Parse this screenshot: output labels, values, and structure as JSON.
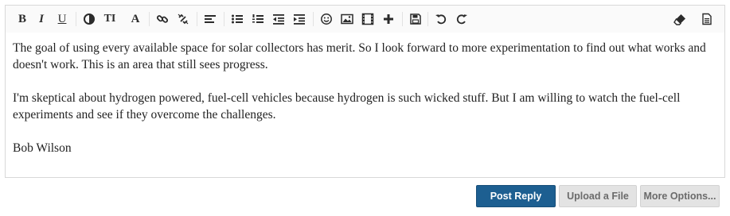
{
  "toolbar": {
    "bold": "B",
    "italic": "I",
    "underline": "U",
    "font_size": "TI",
    "font": "A"
  },
  "message": {
    "paragraphs": [
      "The goal of using every available space for solar collectors has merit. So I look forward to more experimentation to find out what works and doesn't work. This is an area that still sees progress.",
      "I'm skeptical about hydrogen powered, fuel-cell vehicles because hydrogen is such wicked stuff. But I am willing to watch the fuel-cell experiments and see if they overcome the challenges.",
      "Bob Wilson"
    ]
  },
  "actions": {
    "post_reply": "Post Reply",
    "upload_file": "Upload a File",
    "more_options": "More Options..."
  }
}
